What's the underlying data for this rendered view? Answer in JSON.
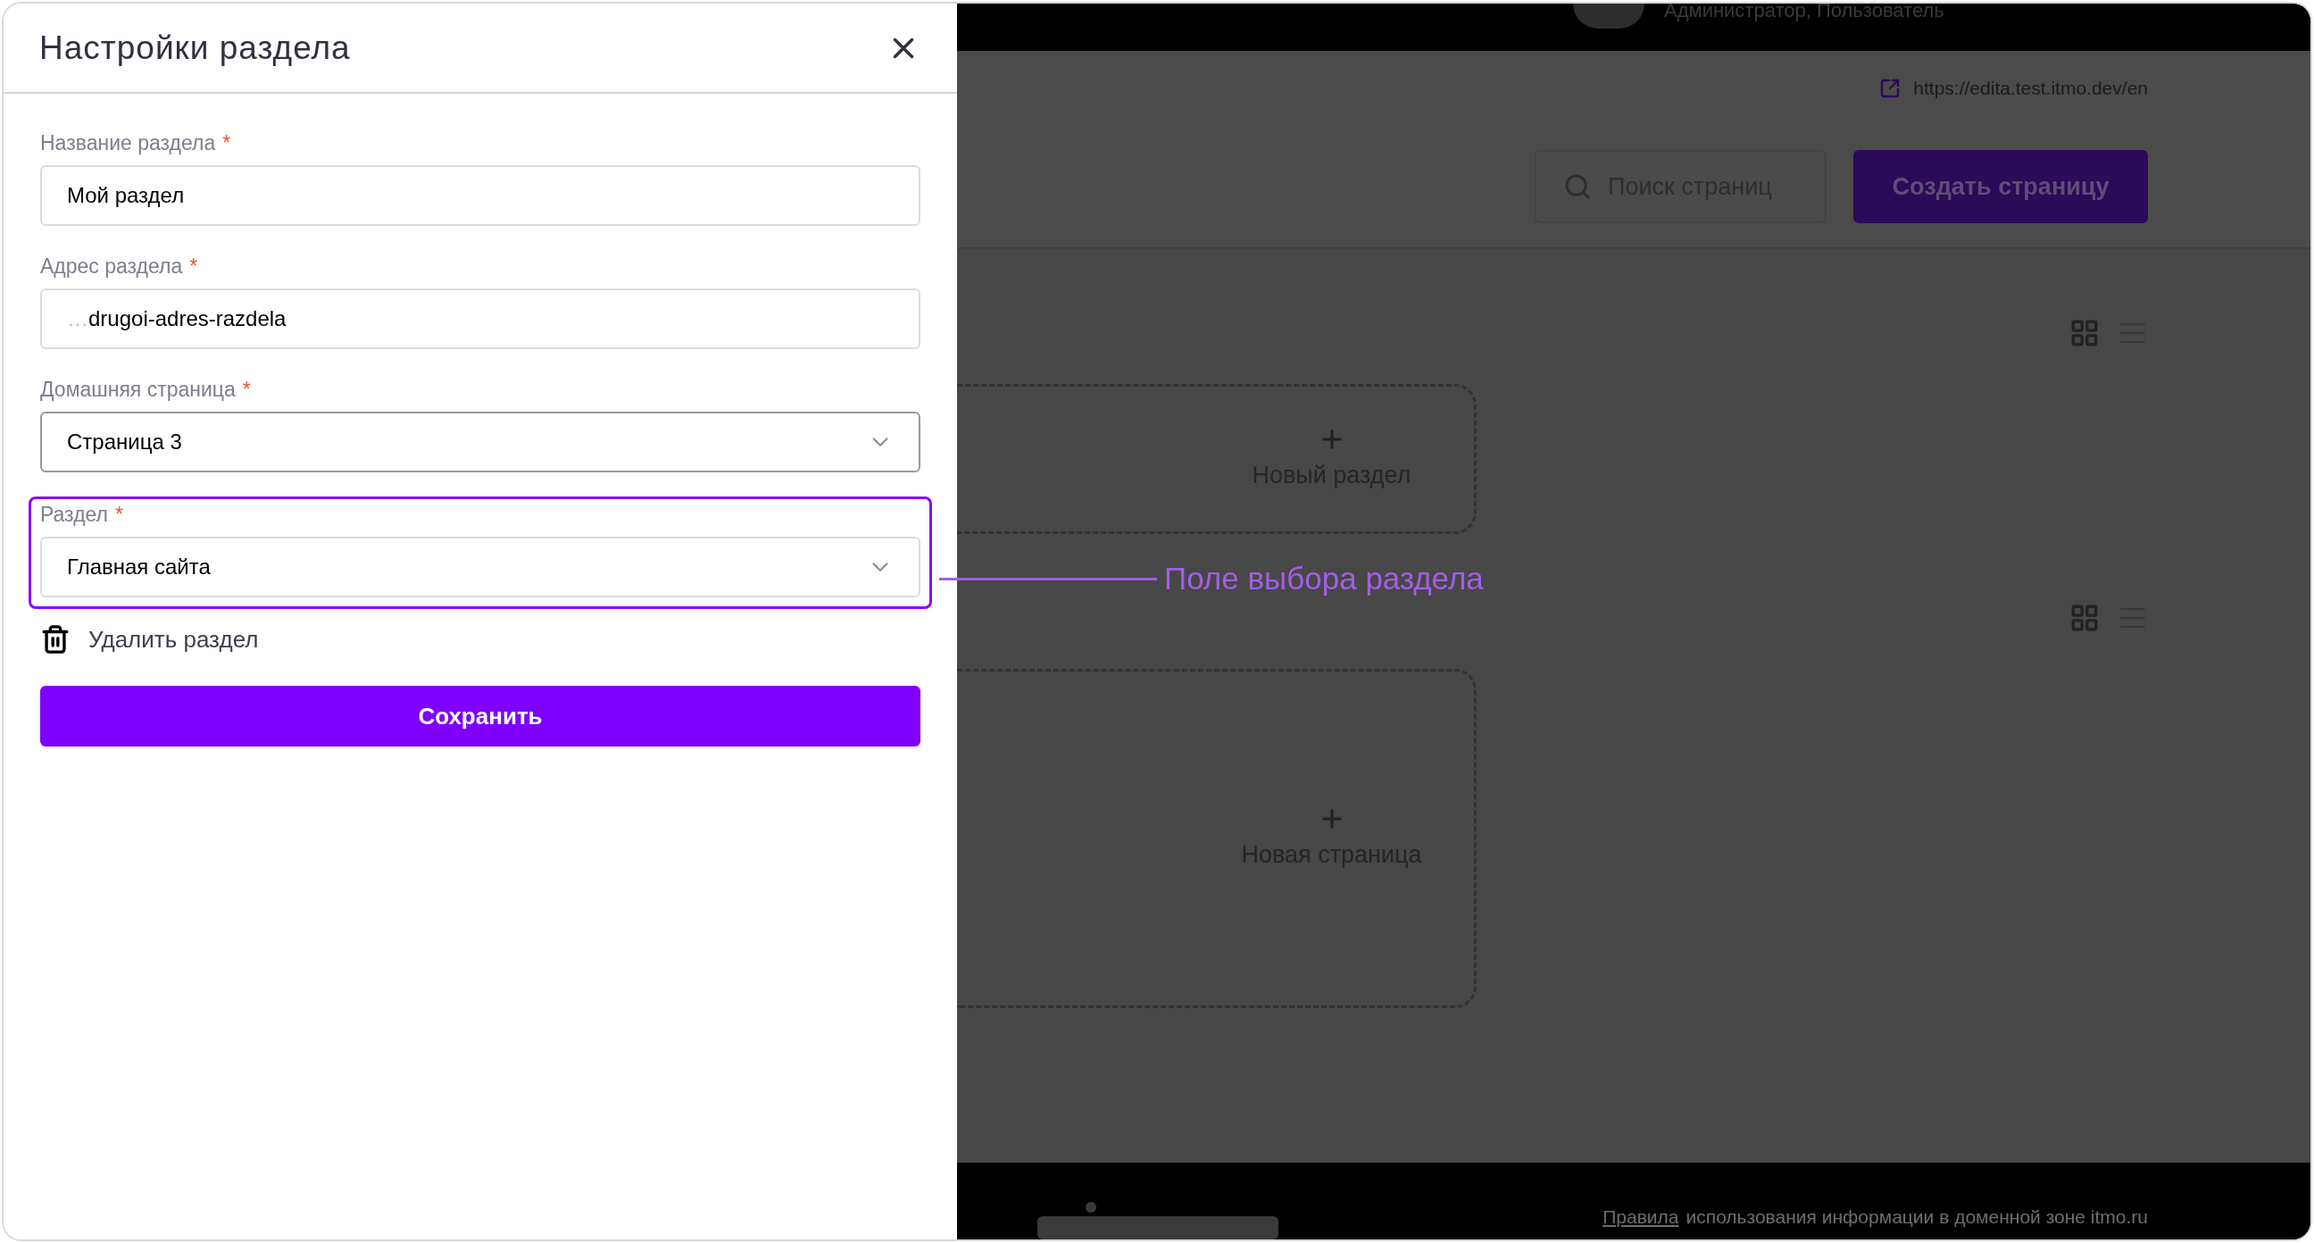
{
  "dialog": {
    "title": "Настройки раздела",
    "fields": [
      {
        "kind": "text",
        "label": "Название раздела",
        "required_mark": "*",
        "value": "Мой раздел",
        "annotated": false
      },
      {
        "kind": "text",
        "label": "Адрес раздела",
        "required_mark": "*",
        "prefix": "…",
        "value": "drugoi-adres-razdela",
        "annotated": false
      },
      {
        "kind": "select",
        "label": "Домашняя страница",
        "required_mark": "*",
        "value": "Страница 3",
        "annotated": false
      },
      {
        "kind": "select",
        "label": "Раздел",
        "required_mark": "*",
        "value": "Главная сайта",
        "annotated": true
      }
    ],
    "delete_link": "Удалить раздел",
    "save_button": "Сохранить"
  },
  "annotation": {
    "text": "Поле выбора раздела"
  },
  "background": {
    "user_role": "Администратор, Пользователь",
    "site_url": "https://edita.test.itmo.dev/en",
    "search_placeholder": "Поиск страниц",
    "create_button": "Создать страницу",
    "sections": [
      {
        "add_label": "Новый раздел"
      },
      {
        "add_label": "Новая страница"
      }
    ],
    "footer": {
      "rules_link": "Правила",
      "rules_text": "использования информации в доменной зоне itmo.ru"
    }
  }
}
